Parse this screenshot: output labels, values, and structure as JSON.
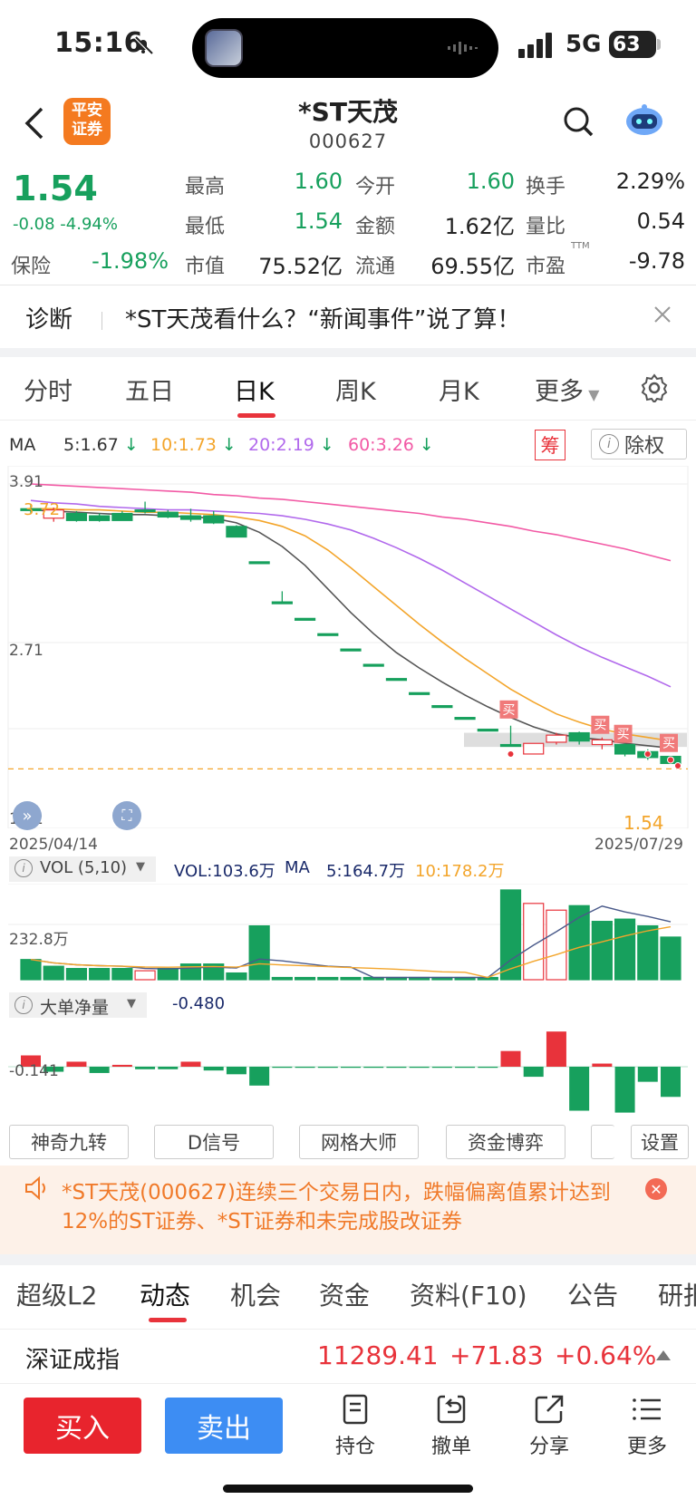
{
  "status_bar": {
    "time": "15:16",
    "network": "5G",
    "battery": "63"
  },
  "header": {
    "logo_text": "平安证券",
    "stock_name": "*ST天茂",
    "stock_code": "000627"
  },
  "quote": {
    "price": "1.54",
    "change": "-0.08 -4.94%",
    "sector_label": "保险",
    "sector_change": "-1.98%",
    "stats": [
      {
        "label": "最高",
        "value": "1.60",
        "color": "#17a05d"
      },
      {
        "label": "今开",
        "value": "1.60",
        "color": "#17a05d"
      },
      {
        "label": "换手",
        "value": "2.29%",
        "color": "#222"
      },
      {
        "label": "最低",
        "value": "1.54",
        "color": "#17a05d"
      },
      {
        "label": "金额",
        "value": "1.62亿",
        "color": "#222"
      },
      {
        "label": "量比",
        "value": "0.54",
        "color": "#222"
      },
      {
        "label": "市值",
        "value": "75.52亿",
        "color": "#222"
      },
      {
        "label": "流通",
        "value": "69.55亿",
        "color": "#222"
      },
      {
        "label": "市盈",
        "value": "-9.78",
        "color": "#222"
      }
    ],
    "pe_superscript": "TTM"
  },
  "diagnosis": {
    "label": "诊断",
    "text": "*ST天茂看什么？“新闻事件”说了算！"
  },
  "chart_tabs": [
    "分时",
    "五日",
    "日K",
    "周K",
    "月K",
    "更多"
  ],
  "chart_tabs_active": "日K",
  "ma_legend": {
    "title": "MA",
    "items": [
      {
        "text": "5:1.67",
        "color": "#333333"
      },
      {
        "text": "10:1.73",
        "color": "#f3a52b"
      },
      {
        "text": "20:2.19",
        "color": "#b169ec"
      },
      {
        "text": "60:3.26",
        "color": "#f25aa5"
      }
    ],
    "chip_label": "筹",
    "fq_label": "除权"
  },
  "chart_labels": {
    "y_max": "3.91",
    "y_mid": "2.71",
    "y_min": "1.22",
    "left_marker": "3.72",
    "last_price": "1.54",
    "date_start": "2025/04/14",
    "date_end": "2025/07/29",
    "buy_tag": "买"
  },
  "volume_panel": {
    "selector": "VOL (5,10)",
    "vol": "VOL:103.6万",
    "ma_title": "MA",
    "ma5": "5:164.7万",
    "ma10": "10:178.2万",
    "y_label": "232.8万"
  },
  "flow_panel": {
    "selector": "大单净量",
    "value": "-0.480",
    "y_label": "-0.141"
  },
  "indicator_buttons": [
    "神奇九转",
    "D信号",
    "网格大师",
    "资金博弈",
    "设置"
  ],
  "notice": {
    "text": "*ST天茂(000627)连续三个交易日内，跌幅偏离值累计达到12%的ST证券、*ST证券和未完成股改证券"
  },
  "bottom_tabs": [
    "超级L2",
    "动态",
    "机会",
    "资金",
    "资料(F10)",
    "公告",
    "研报"
  ],
  "bottom_tabs_active": "动态",
  "index_ticker": {
    "name": "深证成指",
    "value": "11289.41",
    "change": "+71.83",
    "pct": "+0.64%"
  },
  "actions": {
    "buy": "买入",
    "sell": "卖出",
    "position": "持仓",
    "cancel": "撤单",
    "share": "分享",
    "more": "更多"
  },
  "chart_data": {
    "type": "candlestick",
    "x_range": [
      "2025/04/14",
      "2025/07/29"
    ],
    "ylim": [
      1.22,
      3.91
    ],
    "y_ticks": [
      "3.91",
      "2.71",
      "1.22"
    ],
    "candles": [
      {
        "o": 3.7,
        "c": 3.7,
        "h": 3.74,
        "l": 3.66
      },
      {
        "o": 3.62,
        "c": 3.69,
        "h": 3.71,
        "l": 3.59
      },
      {
        "o": 3.66,
        "c": 3.6,
        "h": 3.68,
        "l": 3.59
      },
      {
        "o": 3.64,
        "c": 3.6,
        "h": 3.66,
        "l": 3.59
      },
      {
        "o": 3.66,
        "c": 3.6,
        "h": 3.68,
        "l": 3.6
      },
      {
        "o": 3.69,
        "c": 3.69,
        "h": 3.76,
        "l": 3.66
      },
      {
        "o": 3.67,
        "c": 3.63,
        "h": 3.69,
        "l": 3.62
      },
      {
        "o": 3.64,
        "c": 3.61,
        "h": 3.7,
        "l": 3.59
      },
      {
        "o": 3.64,
        "c": 3.58,
        "h": 3.68,
        "l": 3.57
      },
      {
        "o": 3.55,
        "c": 3.46,
        "h": 3.56,
        "l": 3.46
      },
      {
        "o": 3.25,
        "c": 3.25,
        "h": 3.25,
        "l": 3.25
      },
      {
        "o": 2.91,
        "c": 2.91,
        "h": 3.0,
        "l": 2.91
      },
      {
        "o": 2.77,
        "c": 2.77,
        "h": 2.77,
        "l": 2.77
      },
      {
        "o": 2.64,
        "c": 2.64,
        "h": 2.64,
        "l": 2.64
      },
      {
        "o": 2.51,
        "c": 2.51,
        "h": 2.51,
        "l": 2.51
      },
      {
        "o": 2.38,
        "c": 2.38,
        "h": 2.38,
        "l": 2.38
      },
      {
        "o": 2.26,
        "c": 2.26,
        "h": 2.26,
        "l": 2.26
      },
      {
        "o": 2.14,
        "c": 2.14,
        "h": 2.14,
        "l": 2.14
      },
      {
        "o": 2.03,
        "c": 2.03,
        "h": 2.03,
        "l": 2.03
      },
      {
        "o": 1.93,
        "c": 1.93,
        "h": 1.93,
        "l": 1.93
      },
      {
        "o": 1.83,
        "c": 1.83,
        "h": 1.83,
        "l": 1.83
      },
      {
        "o": 1.7,
        "c": 1.7,
        "h": 1.86,
        "l": 1.7
      },
      {
        "o": 1.62,
        "c": 1.71,
        "h": 1.71,
        "l": 1.62
      },
      {
        "o": 1.72,
        "c": 1.78,
        "h": 1.8,
        "l": 1.7
      },
      {
        "o": 1.8,
        "c": 1.73,
        "h": 1.81,
        "l": 1.7
      },
      {
        "o": 1.7,
        "c": 1.74,
        "h": 1.76,
        "l": 1.66
      },
      {
        "o": 1.7,
        "c": 1.62,
        "h": 1.71,
        "l": 1.6
      },
      {
        "o": 1.64,
        "c": 1.59,
        "h": 1.66,
        "l": 1.57
      },
      {
        "o": 1.6,
        "c": 1.54,
        "h": 1.6,
        "l": 1.54
      }
    ],
    "ma": {
      "ma5": [
        3.69,
        3.68,
        3.67,
        3.66,
        3.65,
        3.65,
        3.64,
        3.63,
        3.62,
        3.58,
        3.5,
        3.38,
        3.22,
        3.02,
        2.82,
        2.64,
        2.48,
        2.35,
        2.23,
        2.12,
        2.02,
        1.93,
        1.85,
        1.79,
        1.76,
        1.74,
        1.71,
        1.69,
        1.67
      ],
      "ma10": [
        3.7,
        3.7,
        3.69,
        3.69,
        3.68,
        3.67,
        3.67,
        3.66,
        3.65,
        3.63,
        3.6,
        3.55,
        3.47,
        3.35,
        3.2,
        3.04,
        2.88,
        2.72,
        2.57,
        2.43,
        2.3,
        2.17,
        2.06,
        1.96,
        1.89,
        1.83,
        1.79,
        1.76,
        1.73
      ],
      "ma20": [
        3.77,
        3.75,
        3.74,
        3.72,
        3.71,
        3.7,
        3.69,
        3.69,
        3.68,
        3.67,
        3.66,
        3.64,
        3.61,
        3.57,
        3.52,
        3.45,
        3.37,
        3.28,
        3.18,
        3.07,
        2.96,
        2.85,
        2.74,
        2.63,
        2.53,
        2.44,
        2.36,
        2.28,
        2.19
      ],
      "ma60": [
        3.91,
        3.9,
        3.89,
        3.88,
        3.87,
        3.86,
        3.85,
        3.84,
        3.82,
        3.81,
        3.79,
        3.78,
        3.76,
        3.74,
        3.72,
        3.7,
        3.68,
        3.66,
        3.63,
        3.61,
        3.58,
        3.55,
        3.51,
        3.48,
        3.44,
        3.4,
        3.36,
        3.31,
        3.26
      ]
    },
    "volume": [
      0.9,
      0.6,
      0.5,
      0.5,
      0.5,
      0.4,
      0.5,
      0.7,
      0.7,
      0.3,
      2.4,
      0.1,
      0.1,
      0.1,
      0.1,
      0.1,
      0.1,
      0.1,
      0.1,
      0.1,
      0.1,
      4.0,
      3.4,
      3.1,
      3.3,
      2.6,
      2.7,
      2.4,
      1.9
    ],
    "volume_up": [
      false,
      false,
      false,
      false,
      false,
      true,
      false,
      false,
      false,
      false,
      false,
      false,
      false,
      false,
      false,
      false,
      false,
      false,
      false,
      false,
      false,
      false,
      true,
      true,
      false,
      false,
      false,
      false,
      false
    ],
    "net_flow": [
      0.18,
      -0.08,
      0.08,
      -0.1,
      0.03,
      -0.04,
      -0.04,
      0.08,
      -0.06,
      -0.12,
      -0.3,
      -0.01,
      -0.01,
      -0.01,
      -0.01,
      -0.01,
      -0.01,
      -0.01,
      -0.01,
      -0.01,
      -0.01,
      0.25,
      -0.16,
      0.56,
      -0.7,
      0.05,
      -0.73,
      -0.24,
      -0.48
    ]
  }
}
